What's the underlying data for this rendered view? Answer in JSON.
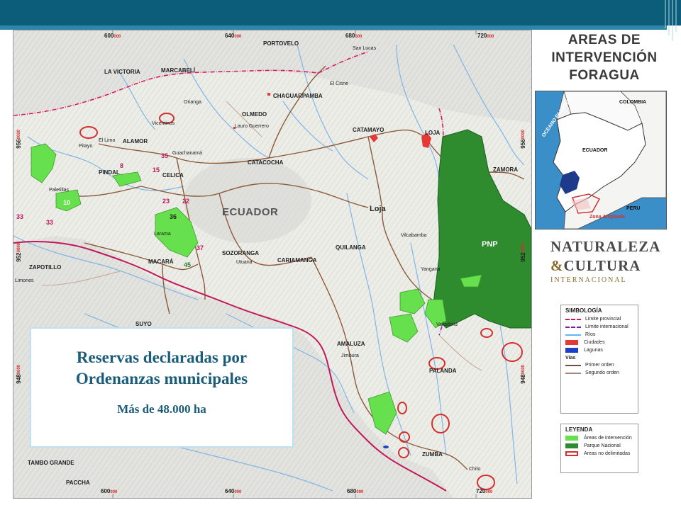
{
  "callout": {
    "title_line1": "Reservas declaradas por",
    "title_line2": "Ordenanzas municipales",
    "subtitle": "Más de 48.000 ha"
  },
  "sidebar": {
    "title_line1": "AREAS DE",
    "title_line2": "INTERVENCIÓN",
    "title_line3": "FORAGUA"
  },
  "inset": {
    "labels": {
      "colombia": "COLOMBIA",
      "ocean": "OCEANO PACIFICO",
      "ecuador": "ECUADOR",
      "peru": "PERU",
      "zone": "Zona Ampliada"
    }
  },
  "brand": {
    "line1": "NATURALEZA",
    "amp": "&",
    "line2": "CULTURA",
    "line3": "INTERNACIONAL"
  },
  "symbology": {
    "title": "SIMBOLOGÍA",
    "items": [
      {
        "label": "Limite provincial",
        "color": "#c2185b",
        "style": "dashdot"
      },
      {
        "label": "Límite internacional",
        "color": "#7b1fa2",
        "style": "dashdot"
      },
      {
        "label": "Ríos",
        "color": "#64b5f6",
        "style": "solid"
      },
      {
        "label": "Ciudades",
        "color": "#e53935",
        "style": "box"
      },
      {
        "label": "Lagunas",
        "color": "#1e40c8",
        "style": "box"
      }
    ],
    "roads_title": "Vías",
    "roads": [
      {
        "label": "Primer orden",
        "color": "#6d4c41",
        "style": "solid"
      },
      {
        "label": "Segundo orden",
        "color": "#a1887f",
        "style": "solid"
      }
    ]
  },
  "legend": {
    "title": "LEYENDA",
    "items": [
      {
        "label": "Áreas de intervención",
        "color": "#66e04c",
        "style": "box"
      },
      {
        "label": "Parque Nacional",
        "color": "#2e8b2e",
        "style": "box"
      },
      {
        "label": "Areas no delimitadas",
        "color": "#d32f2f",
        "style": "outline"
      }
    ]
  },
  "map": {
    "country_label": "ECUADOR",
    "park_label": "PNP",
    "towns": [
      {
        "id": "portovelo",
        "name": "PORTOVELO"
      },
      {
        "id": "san-lucas",
        "name": "San Lucas"
      },
      {
        "id": "la-victoria",
        "name": "LA VICTORIA"
      },
      {
        "id": "marcabeli",
        "name": "MARCABELÍ"
      },
      {
        "id": "el-cisne",
        "name": "El Cisne"
      },
      {
        "id": "chaguarpamba",
        "name": "CHAGUARPAMBA"
      },
      {
        "id": "orianga",
        "name": "Orianga"
      },
      {
        "id": "olmedo",
        "name": "OLMEDO"
      },
      {
        "id": "vicentinos",
        "name": "Vicentinos"
      },
      {
        "id": "lauro-guerrero",
        "name": "Lauro Guerrero"
      },
      {
        "id": "catamayo",
        "name": "CATAMAYO"
      },
      {
        "id": "loja-city",
        "name": "LOJA"
      },
      {
        "id": "el-limo",
        "name": "El Limo"
      },
      {
        "id": "alamor",
        "name": "ALAMOR"
      },
      {
        "id": "pitayo",
        "name": "Pitayo"
      },
      {
        "id": "guachanama",
        "name": "Guachanamá"
      },
      {
        "id": "celica",
        "name": "CELICA"
      },
      {
        "id": "catacocha",
        "name": "CATACOCHA"
      },
      {
        "id": "zamora",
        "name": "ZAMORA"
      },
      {
        "id": "pindal",
        "name": "PINDAL"
      },
      {
        "id": "paletillas",
        "name": "Paletillas"
      },
      {
        "id": "loja",
        "name": "Loja"
      },
      {
        "id": "larama",
        "name": "Larama"
      },
      {
        "id": "vilcabamba",
        "name": "Vilcabamba"
      },
      {
        "id": "sozoranga",
        "name": "SOZORANGA"
      },
      {
        "id": "quilanga",
        "name": "QUILANGA"
      },
      {
        "id": "zapotillo",
        "name": "ZAPOTILLO"
      },
      {
        "id": "cariamanga",
        "name": "CARIAMANGA"
      },
      {
        "id": "macara",
        "name": "MACARÁ"
      },
      {
        "id": "utuana",
        "name": "Utuana"
      },
      {
        "id": "yangana",
        "name": "Yangana"
      },
      {
        "id": "limones",
        "name": "Limones"
      },
      {
        "id": "suyo",
        "name": "SUYO"
      },
      {
        "id": "valladolid",
        "name": "Valladolid"
      },
      {
        "id": "amaluza",
        "name": "AMALUZA"
      },
      {
        "id": "jimbura",
        "name": "Jimbura"
      },
      {
        "id": "palanda",
        "name": "PALANDA"
      },
      {
        "id": "zumba",
        "name": "ZUMBA"
      },
      {
        "id": "tambo-grande",
        "name": "TAMBO GRANDE"
      },
      {
        "id": "paccha",
        "name": "PACCHA"
      },
      {
        "id": "chito",
        "name": "Chito"
      }
    ],
    "numbers": [
      {
        "id": "n8",
        "text": "8"
      },
      {
        "id": "n35",
        "text": "35"
      },
      {
        "id": "n15",
        "text": "15"
      },
      {
        "id": "n10",
        "text": "10"
      },
      {
        "id": "n33a",
        "text": "33"
      },
      {
        "id": "n33b",
        "text": "33"
      },
      {
        "id": "n23",
        "text": "23"
      },
      {
        "id": "n22",
        "text": "22"
      },
      {
        "id": "n36",
        "text": "36"
      },
      {
        "id": "n37",
        "text": "37"
      },
      {
        "id": "n45",
        "text": "45"
      }
    ],
    "coords_top": [
      {
        "main": "600",
        "sub": "000"
      },
      {
        "main": "640",
        "sub": "000"
      },
      {
        "main": "680",
        "sub": "000"
      },
      {
        "main": "720",
        "sub": "000"
      }
    ],
    "coords_bottom": [
      {
        "main": "600",
        "sub": "000"
      },
      {
        "main": "640",
        "sub": "000"
      },
      {
        "main": "680",
        "sub": "000"
      },
      {
        "main": "720",
        "sub": "000"
      }
    ],
    "coords_left": [
      {
        "main": "956",
        "sub": "0000"
      },
      {
        "main": "952",
        "sub": "0000"
      },
      {
        "main": "948",
        "sub": "0000"
      }
    ],
    "coords_right": [
      {
        "main": "956",
        "sub": "0000"
      },
      {
        "main": "952",
        "sub": "0000"
      },
      {
        "main": "948",
        "sub": "0000"
      }
    ]
  }
}
